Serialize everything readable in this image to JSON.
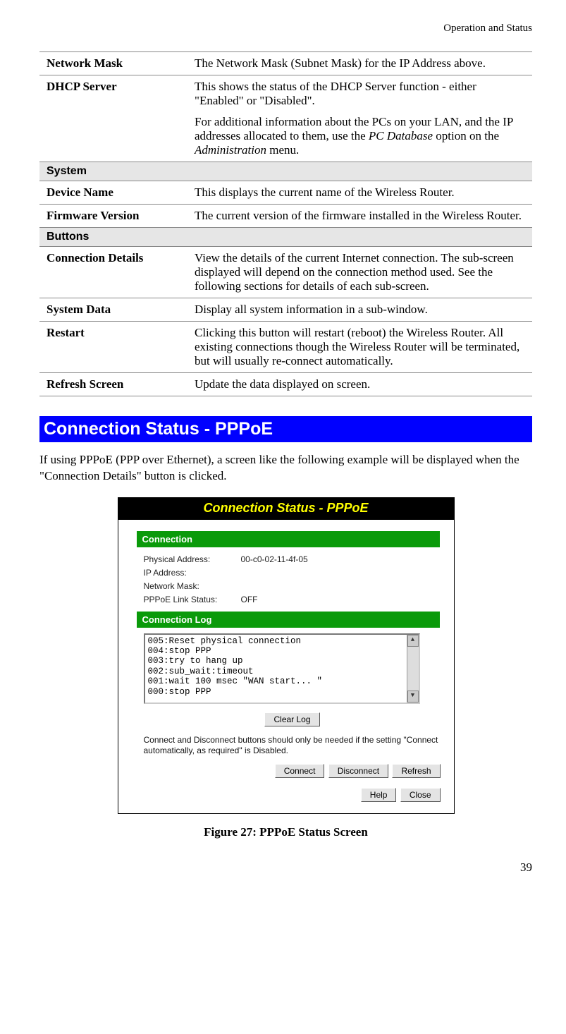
{
  "page_header": "Operation and Status",
  "page_number": "39",
  "table_rows": {
    "network_mask_lbl": "Network Mask",
    "network_mask_val": "The Network Mask (Subnet Mask) for the IP Address above.",
    "dhcp_lbl": "DHCP Server",
    "dhcp_p1": "This shows the status of the DHCP Server function - either \"Enabled\" or \"Disabled\".",
    "dhcp_p2a": "For additional information about the PCs on your LAN, and the IP addresses allocated to them, use the ",
    "dhcp_p2_em1": "PC Database",
    "dhcp_p2b": " option on the ",
    "dhcp_p2_em2": "Administration",
    "dhcp_p2c": " menu.",
    "sect_system": "System",
    "devname_lbl": "Device Name",
    "devname_val": "This displays the current name of the Wireless Router.",
    "fw_lbl": "Firmware Version",
    "fw_val": "The current version of the firmware installed in the Wireless Router.",
    "sect_buttons": "Buttons",
    "cd_lbl": "Connection Details",
    "cd_val": "View the details of the current Internet connection. The sub-screen displayed will depend on the connection method used. See the following sections for details of each sub-screen.",
    "sd_lbl": "System Data",
    "sd_val": "Display all system information in a sub-window.",
    "rs_lbl": "Restart",
    "rs_val": "Clicking this button will restart (reboot) the Wireless Router. All existing connections though the Wireless Router will be terminated, but will usually re-connect automatically.",
    "rf_lbl": "Refresh Screen",
    "rf_val": "Update the data displayed on screen."
  },
  "banner": "Connection Status - PPPoE",
  "intro": "If using PPPoE (PPP over Ethernet), a screen like the following example will be displayed when the \"Connection Details\" button is clicked.",
  "screenshot": {
    "title": "Connection Status - PPPoE",
    "sect_conn": "Connection",
    "kv": {
      "k1": "Physical Address:",
      "v1": "00-c0-02-11-4f-05",
      "k2": "IP Address:",
      "v2": "",
      "k3": "Network Mask:",
      "v3": "",
      "k4": "PPPoE Link Status:",
      "v4": "OFF"
    },
    "sect_log": "Connection Log",
    "log": {
      "l1": "005:Reset physical connection",
      "l2": "004:stop PPP",
      "l3": "003:try to hang up",
      "l4": "002:sub_wait:timeout",
      "l5": "001:wait 100 msec \"WAN start...  \"",
      "l6": "000:stop PPP"
    },
    "btn_clear": "Clear Log",
    "hint": "Connect and Disconnect buttons should only be needed if the setting \"Connect automatically, as required\" is Disabled.",
    "btn_connect": "Connect",
    "btn_disconnect": "Disconnect",
    "btn_refresh": "Refresh",
    "btn_help": "Help",
    "btn_close": "Close"
  },
  "caption": "Figure 27: PPPoE Status Screen"
}
